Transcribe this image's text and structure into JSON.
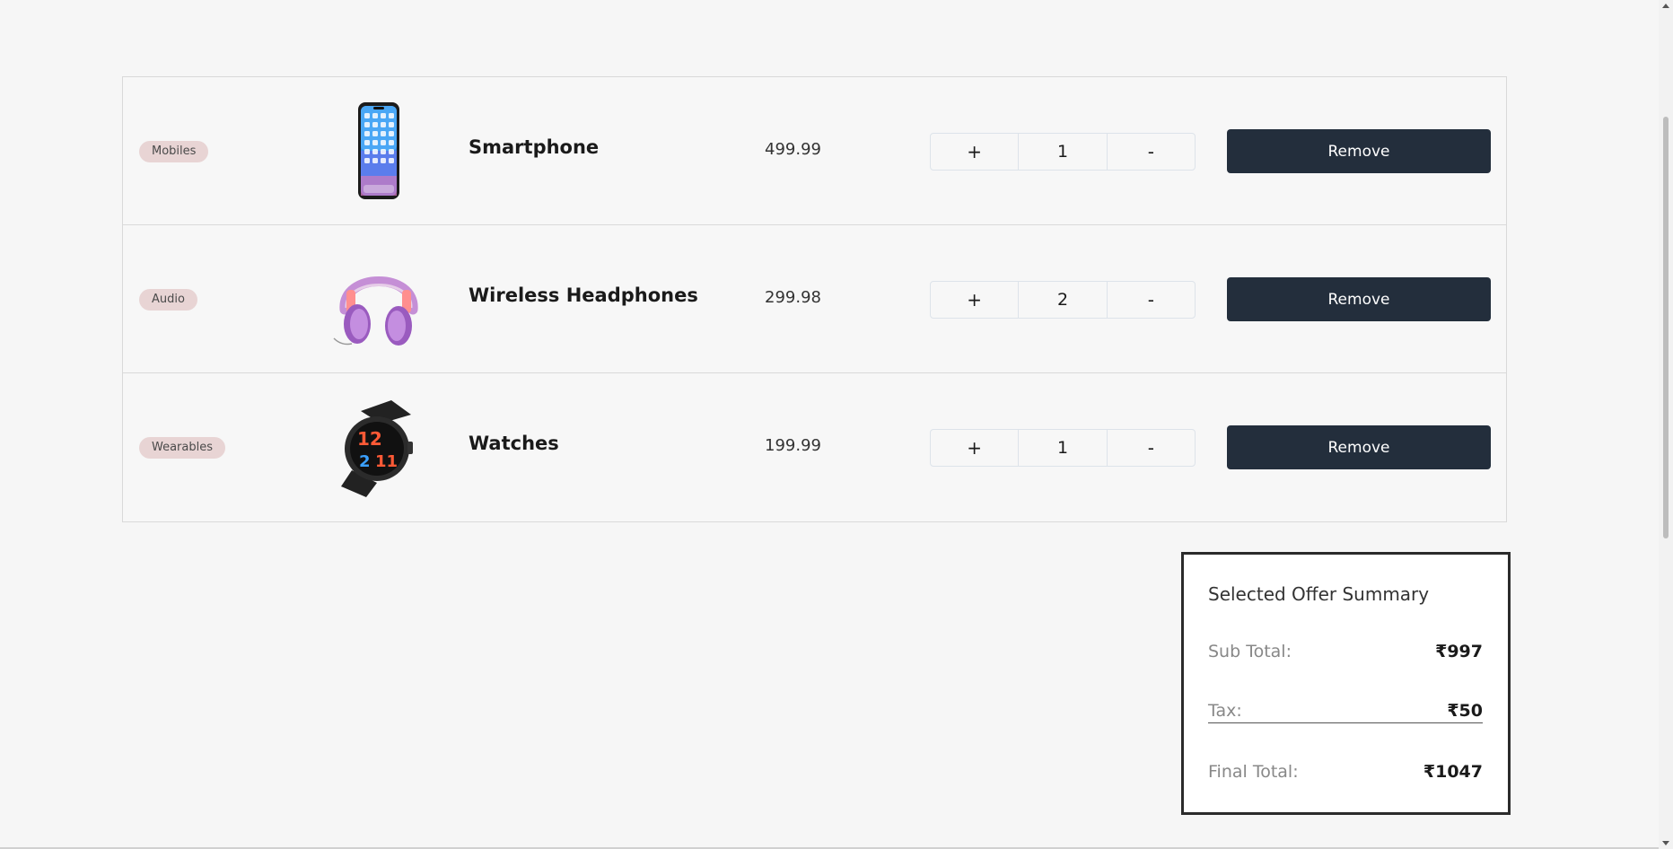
{
  "cart": {
    "items": [
      {
        "category": "Mobiles",
        "image": "smartphone-image",
        "name": "Smartphone",
        "price": "499.99",
        "plus": "+",
        "quantity": "1",
        "minus": "-",
        "remove_label": "Remove"
      },
      {
        "category": "Audio",
        "image": "headphones-image",
        "name": "Wireless Headphones",
        "price": "299.98",
        "plus": "+",
        "quantity": "2",
        "minus": "-",
        "remove_label": "Remove"
      },
      {
        "category": "Wearables",
        "image": "watch-image",
        "name": "Watches",
        "price": "199.99",
        "plus": "+",
        "quantity": "1",
        "minus": "-",
        "remove_label": "Remove"
      }
    ]
  },
  "summary": {
    "title": "Selected Offer Summary",
    "subtotal_label": "Sub Total:",
    "subtotal_value": "₹997",
    "tax_label": "Tax:",
    "tax_value": "₹50",
    "final_label": "Final Total:",
    "final_value": "₹1047"
  },
  "colors": {
    "background": "#f6f6f6",
    "button": "#232e3c",
    "badge": "#e8d4d4"
  }
}
